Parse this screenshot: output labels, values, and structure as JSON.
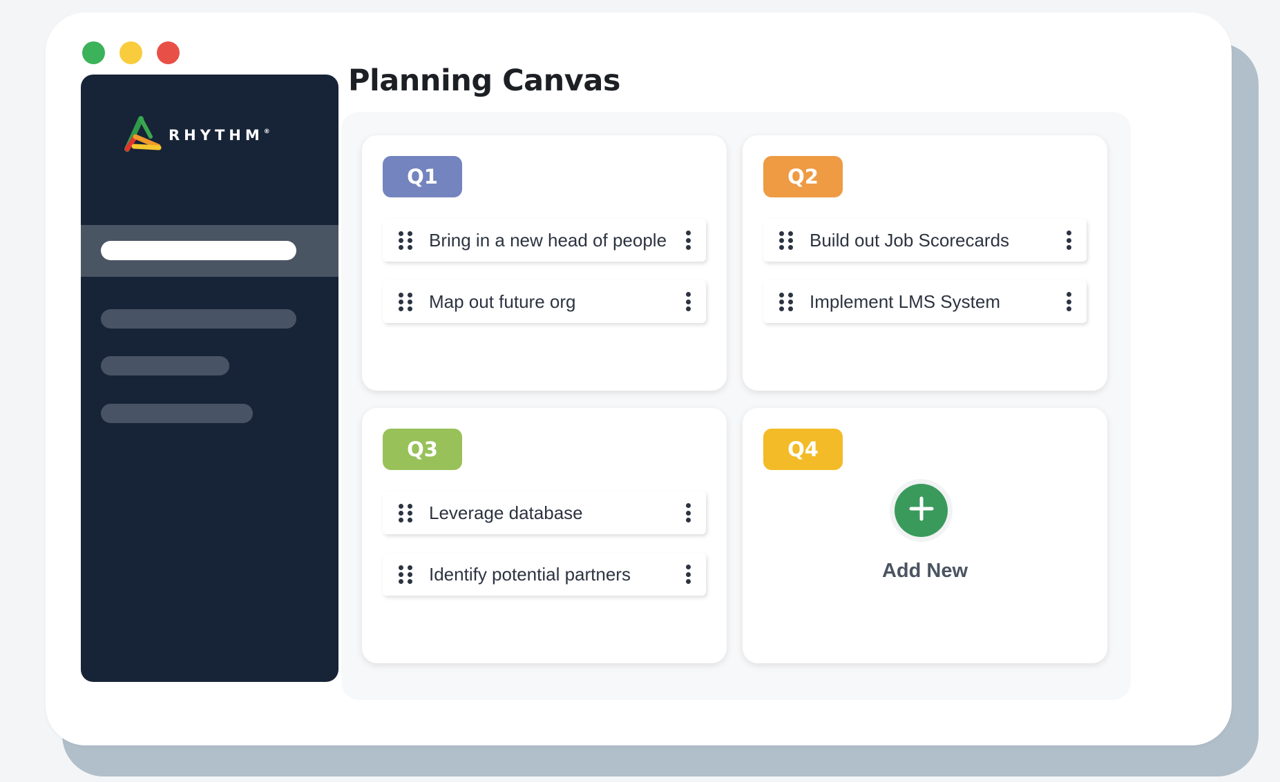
{
  "window": {
    "controls": [
      {
        "name": "green",
        "color": "#3cb25b"
      },
      {
        "name": "yellow",
        "color": "#f8cc3d"
      },
      {
        "name": "red",
        "color": "#e84f47"
      }
    ]
  },
  "sidebar": {
    "brand": "RHYTHM",
    "trademark": "®",
    "logo_icon": "rhythm-triangle-logo"
  },
  "page": {
    "title": "Planning Canvas"
  },
  "quadrants": [
    {
      "label": "Q1",
      "color": "#7384bf",
      "tasks": [
        "Bring in a new head of people",
        "Map out future org"
      ]
    },
    {
      "label": "Q2",
      "color": "#ee9b44",
      "tasks": [
        "Build out Job Scorecards",
        "Implement LMS System"
      ]
    },
    {
      "label": "Q3",
      "color": "#98c15a",
      "tasks": [
        "Leverage database",
        "Identify potential partners"
      ]
    },
    {
      "label": "Q4",
      "color": "#f3bb28",
      "add_new_label": "Add New",
      "add_icon": "plus-icon",
      "add_color": "#3a9a5c"
    }
  ],
  "icons": {
    "drag": "drag-handle-icon",
    "menu": "more-vertical-icon"
  }
}
